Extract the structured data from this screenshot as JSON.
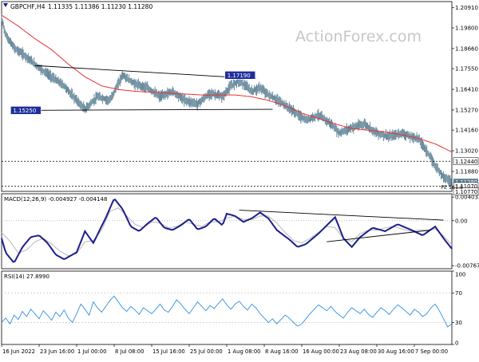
{
  "header": {
    "symbol": "GBPCHF,H4",
    "ohlc": "1.11335 1.11386 1.11230 1.11280",
    "watermark": "ActionForex.com"
  },
  "colors": {
    "price": "#5a7f93",
    "ma": "#e8312f",
    "macd_line": "#1b1f8c",
    "macd_signal": "#b8b8b8",
    "rsi": "#2f8fe0",
    "label_bg": "#1f2d9c",
    "trendline": "#000000",
    "rsi_grid": "#c9c9c9"
  },
  "chart_data": [
    {
      "type": "line",
      "panel": "price",
      "ylim": [
        1.1078,
        1.2125
      ],
      "y_ticks": [
        "1.20910",
        "1.19800",
        "1.18660",
        "1.17550",
        "1.16410",
        "1.15270",
        "1.14160",
        "1.13020",
        "1.11880"
      ],
      "y_tick_values": [
        1.2091,
        1.198,
        1.1866,
        1.1755,
        1.1641,
        1.1527,
        1.1416,
        1.1302,
        1.1188
      ],
      "x_tick_labels": [
        "16 Jun 2022",
        "23 Jun 16:00",
        "1 Jul 00:00",
        "8 Jul 08:00",
        "15 Jul 16:00",
        "25 Jul 00:00",
        "1 Aug 08:00",
        "8 Aug 16:00",
        "16 Aug 00:00",
        "23 Aug 08:00",
        "30 Aug 16:00",
        "7 Sep 00:00"
      ],
      "x_tick_index": [
        0,
        45,
        90,
        135,
        180,
        225,
        270,
        315,
        360,
        405,
        450,
        495
      ],
      "n_points": 540,
      "series": [
        {
          "role": "price",
          "x": [
            0,
            5,
            15,
            30,
            45,
            60,
            75,
            90,
            100,
            115,
            130,
            145,
            160,
            175,
            190,
            205,
            220,
            235,
            250,
            265,
            275,
            285,
            300,
            310,
            320,
            335,
            350,
            365,
            380,
            395,
            405,
            420,
            435,
            450,
            465,
            480,
            490,
            500,
            510,
            520,
            530,
            540
          ],
          "y": [
            1.203,
            1.194,
            1.187,
            1.182,
            1.176,
            1.171,
            1.166,
            1.158,
            1.153,
            1.16,
            1.158,
            1.172,
            1.167,
            1.165,
            1.16,
            1.163,
            1.158,
            1.156,
            1.162,
            1.16,
            1.166,
            1.169,
            1.163,
            1.165,
            1.161,
            1.157,
            1.152,
            1.147,
            1.15,
            1.145,
            1.14,
            1.143,
            1.145,
            1.14,
            1.138,
            1.14,
            1.138,
            1.137,
            1.13,
            1.122,
            1.116,
            1.1128
          ]
        },
        {
          "role": "ma",
          "x": [
            0,
            20,
            40,
            60,
            80,
            100,
            120,
            140,
            160,
            180,
            200,
            220,
            240,
            260,
            280,
            300,
            320,
            340,
            360,
            380,
            400,
            420,
            440,
            460,
            480,
            500,
            520,
            540
          ],
          "y": [
            1.205,
            1.199,
            1.192,
            1.186,
            1.178,
            1.171,
            1.166,
            1.164,
            1.163,
            1.1625,
            1.162,
            1.1615,
            1.161,
            1.161,
            1.161,
            1.16,
            1.158,
            1.155,
            1.151,
            1.148,
            1.145,
            1.1425,
            1.1415,
            1.1405,
            1.139,
            1.137,
            1.134,
            1.1295
          ]
        }
      ],
      "trendlines": [
        {
          "x": [
            40,
            305
          ],
          "y": [
            1.1772,
            1.17
          ]
        },
        {
          "x": [
            15,
            325
          ],
          "y": [
            1.1525,
            1.1531
          ]
        },
        {
          "x": [
            0,
            540
          ],
          "y": [
            1.1244,
            1.1244
          ],
          "dashed": true
        },
        {
          "x": [
            0,
            540
          ],
          "y": [
            1.1107,
            1.1107
          ],
          "dashed": true
        }
      ],
      "labels": [
        {
          "text": "1.17190",
          "x": 287,
          "y": 1.1719
        },
        {
          "text": "1.15250",
          "x": 30,
          "y": 1.1525
        },
        {
          "text": "1.12440",
          "axis": true,
          "y": 1.1244
        },
        {
          "text": "1.11280",
          "axis": true,
          "y": 1.1128
        },
        {
          "text": "1.11070",
          "axis": true,
          "y": 1.1107
        },
        {
          "text": "1.10770",
          "axis": true,
          "y": 1.1077
        },
        {
          "text": "FE 161.8",
          "x": 527,
          "y": 1.1107
        }
      ]
    },
    {
      "type": "line",
      "panel": "macd",
      "title": "MACD(12,26,9) -0.004927 -0.004148",
      "ylim": [
        -0.0082,
        0.0046
      ],
      "y_ticks": [
        "0.004032",
        "0.00",
        "-0.007672"
      ],
      "y_tick_values": [
        0.004032,
        0.0,
        -0.007672
      ],
      "series": [
        {
          "role": "macd",
          "x": [
            0,
            5,
            15,
            25,
            35,
            45,
            55,
            65,
            75,
            90,
            100,
            110,
            125,
            135,
            145,
            155,
            165,
            175,
            185,
            195,
            205,
            215,
            225,
            235,
            245,
            255,
            265,
            270,
            280,
            290,
            300,
            310,
            320,
            330,
            345,
            355,
            365,
            380,
            390,
            400,
            410,
            420,
            430,
            445,
            460,
            475,
            490,
            505,
            520,
            530,
            540
          ],
          "y": [
            -0.003,
            -0.0055,
            -0.0072,
            -0.0045,
            -0.0028,
            -0.0025,
            -0.0038,
            -0.0058,
            -0.0066,
            -0.0054,
            -0.0018,
            -0.0038,
            0.0005,
            0.0038,
            0.002,
            -0.001,
            -0.0018,
            -0.0005,
            0.0006,
            -0.0012,
            -0.0016,
            -0.0008,
            0.0003,
            -0.0015,
            -0.001,
            0.0004,
            -0.0008,
            0.0012,
            0.0008,
            -0.0002,
            0.0004,
            0.0014,
            0.0004,
            -0.0016,
            -0.0032,
            -0.0045,
            -0.004,
            -0.0022,
            -0.0008,
            0.0006,
            -0.003,
            -0.0045,
            -0.0028,
            -0.0012,
            -0.0018,
            -0.0006,
            -0.0015,
            -0.0025,
            -0.001,
            -0.003,
            -0.0048
          ]
        },
        {
          "role": "signal",
          "x": [
            0,
            10,
            20,
            30,
            40,
            50,
            60,
            70,
            80,
            90,
            100,
            110,
            120,
            130,
            140,
            150,
            160,
            170,
            180,
            190,
            200,
            210,
            220,
            230,
            240,
            250,
            260,
            270,
            280,
            290,
            300,
            310,
            320,
            330,
            340,
            350,
            360,
            370,
            380,
            390,
            400,
            410,
            420,
            430,
            440,
            450,
            460,
            470,
            480,
            490,
            500,
            510,
            520,
            530,
            540
          ],
          "y": [
            -0.002,
            -0.0035,
            -0.0055,
            -0.005,
            -0.0036,
            -0.003,
            -0.004,
            -0.0052,
            -0.006,
            -0.0056,
            -0.0036,
            -0.0034,
            -0.0016,
            0.0016,
            0.0022,
            0.0008,
            -0.0006,
            -0.0012,
            -0.0002,
            -0.0004,
            -0.0012,
            -0.001,
            -0.0002,
            -0.0006,
            -0.001,
            -0.0002,
            -0.0002,
            0.0004,
            0.0008,
            0.0002,
            0.0002,
            0.0008,
            0.0008,
            -0.0004,
            -0.002,
            -0.0034,
            -0.0038,
            -0.003,
            -0.002,
            -0.001,
            -0.0012,
            -0.003,
            -0.0036,
            -0.0022,
            -0.0016,
            -0.0016,
            -0.0012,
            -0.001,
            -0.0014,
            -0.0018,
            -0.0016,
            -0.0016,
            -0.0014,
            -0.0026,
            -0.0041
          ]
        }
      ],
      "trendlines": [
        {
          "x": [
            285,
            530
          ],
          "y": [
            0.0018,
            0.0001
          ]
        },
        {
          "x": [
            390,
            515
          ],
          "y": [
            -0.0036,
            -0.0016
          ]
        }
      ]
    },
    {
      "type": "line",
      "panel": "rsi",
      "title": "RSI(14) 27.8990",
      "ylim": [
        0,
        100
      ],
      "y_ticks": [
        "100",
        "70",
        "30",
        "0"
      ],
      "y_tick_values": [
        100,
        70,
        30,
        0
      ],
      "series": [
        {
          "role": "rsi",
          "x": [
            0,
            5,
            10,
            15,
            20,
            25,
            30,
            35,
            40,
            45,
            50,
            55,
            60,
            65,
            70,
            75,
            80,
            85,
            90,
            95,
            100,
            105,
            110,
            115,
            120,
            125,
            130,
            135,
            140,
            145,
            150,
            155,
            160,
            165,
            170,
            175,
            180,
            185,
            190,
            195,
            200,
            205,
            210,
            215,
            220,
            225,
            230,
            235,
            240,
            245,
            250,
            255,
            260,
            265,
            270,
            275,
            280,
            285,
            290,
            295,
            300,
            305,
            310,
            315,
            320,
            325,
            330,
            335,
            340,
            345,
            350,
            355,
            360,
            365,
            370,
            375,
            380,
            385,
            390,
            395,
            400,
            405,
            410,
            415,
            420,
            425,
            430,
            435,
            440,
            445,
            450,
            455,
            460,
            465,
            470,
            475,
            480,
            485,
            490,
            495,
            500,
            505,
            510,
            515,
            520,
            525,
            530,
            535,
            540
          ],
          "y": [
            30,
            36,
            28,
            40,
            34,
            45,
            38,
            48,
            42,
            35,
            46,
            40,
            33,
            44,
            38,
            47,
            36,
            30,
            42,
            55,
            48,
            40,
            58,
            50,
            44,
            52,
            60,
            66,
            58,
            50,
            45,
            52,
            47,
            41,
            50,
            46,
            42,
            48,
            55,
            47,
            44,
            52,
            61,
            55,
            48,
            42,
            50,
            58,
            52,
            46,
            53,
            49,
            56,
            62,
            54,
            48,
            55,
            59,
            52,
            47,
            55,
            50,
            42,
            36,
            30,
            35,
            28,
            34,
            40,
            36,
            30,
            25,
            28,
            35,
            42,
            48,
            54,
            50,
            46,
            52,
            45,
            40,
            36,
            44,
            50,
            46,
            42,
            48,
            41,
            37,
            44,
            50,
            46,
            41,
            48,
            54,
            50,
            45,
            40,
            48,
            44,
            38,
            42,
            50,
            55,
            46,
            35,
            24,
            28
          ]
        }
      ]
    }
  ]
}
